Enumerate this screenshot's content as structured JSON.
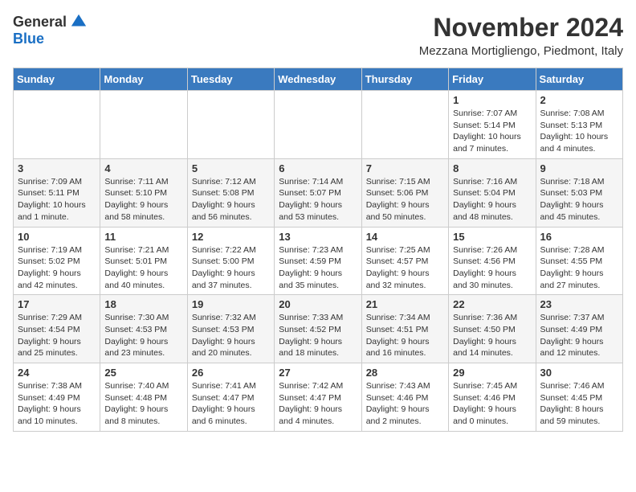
{
  "logo": {
    "general": "General",
    "blue": "Blue"
  },
  "title": "November 2024",
  "location": "Mezzana Mortigliengo, Piedmont, Italy",
  "days_of_week": [
    "Sunday",
    "Monday",
    "Tuesday",
    "Wednesday",
    "Thursday",
    "Friday",
    "Saturday"
  ],
  "weeks": [
    [
      {
        "day": "",
        "info": ""
      },
      {
        "day": "",
        "info": ""
      },
      {
        "day": "",
        "info": ""
      },
      {
        "day": "",
        "info": ""
      },
      {
        "day": "",
        "info": ""
      },
      {
        "day": "1",
        "info": "Sunrise: 7:07 AM\nSunset: 5:14 PM\nDaylight: 10 hours and 7 minutes."
      },
      {
        "day": "2",
        "info": "Sunrise: 7:08 AM\nSunset: 5:13 PM\nDaylight: 10 hours and 4 minutes."
      }
    ],
    [
      {
        "day": "3",
        "info": "Sunrise: 7:09 AM\nSunset: 5:11 PM\nDaylight: 10 hours and 1 minute."
      },
      {
        "day": "4",
        "info": "Sunrise: 7:11 AM\nSunset: 5:10 PM\nDaylight: 9 hours and 58 minutes."
      },
      {
        "day": "5",
        "info": "Sunrise: 7:12 AM\nSunset: 5:08 PM\nDaylight: 9 hours and 56 minutes."
      },
      {
        "day": "6",
        "info": "Sunrise: 7:14 AM\nSunset: 5:07 PM\nDaylight: 9 hours and 53 minutes."
      },
      {
        "day": "7",
        "info": "Sunrise: 7:15 AM\nSunset: 5:06 PM\nDaylight: 9 hours and 50 minutes."
      },
      {
        "day": "8",
        "info": "Sunrise: 7:16 AM\nSunset: 5:04 PM\nDaylight: 9 hours and 48 minutes."
      },
      {
        "day": "9",
        "info": "Sunrise: 7:18 AM\nSunset: 5:03 PM\nDaylight: 9 hours and 45 minutes."
      }
    ],
    [
      {
        "day": "10",
        "info": "Sunrise: 7:19 AM\nSunset: 5:02 PM\nDaylight: 9 hours and 42 minutes."
      },
      {
        "day": "11",
        "info": "Sunrise: 7:21 AM\nSunset: 5:01 PM\nDaylight: 9 hours and 40 minutes."
      },
      {
        "day": "12",
        "info": "Sunrise: 7:22 AM\nSunset: 5:00 PM\nDaylight: 9 hours and 37 minutes."
      },
      {
        "day": "13",
        "info": "Sunrise: 7:23 AM\nSunset: 4:59 PM\nDaylight: 9 hours and 35 minutes."
      },
      {
        "day": "14",
        "info": "Sunrise: 7:25 AM\nSunset: 4:57 PM\nDaylight: 9 hours and 32 minutes."
      },
      {
        "day": "15",
        "info": "Sunrise: 7:26 AM\nSunset: 4:56 PM\nDaylight: 9 hours and 30 minutes."
      },
      {
        "day": "16",
        "info": "Sunrise: 7:28 AM\nSunset: 4:55 PM\nDaylight: 9 hours and 27 minutes."
      }
    ],
    [
      {
        "day": "17",
        "info": "Sunrise: 7:29 AM\nSunset: 4:54 PM\nDaylight: 9 hours and 25 minutes."
      },
      {
        "day": "18",
        "info": "Sunrise: 7:30 AM\nSunset: 4:53 PM\nDaylight: 9 hours and 23 minutes."
      },
      {
        "day": "19",
        "info": "Sunrise: 7:32 AM\nSunset: 4:53 PM\nDaylight: 9 hours and 20 minutes."
      },
      {
        "day": "20",
        "info": "Sunrise: 7:33 AM\nSunset: 4:52 PM\nDaylight: 9 hours and 18 minutes."
      },
      {
        "day": "21",
        "info": "Sunrise: 7:34 AM\nSunset: 4:51 PM\nDaylight: 9 hours and 16 minutes."
      },
      {
        "day": "22",
        "info": "Sunrise: 7:36 AM\nSunset: 4:50 PM\nDaylight: 9 hours and 14 minutes."
      },
      {
        "day": "23",
        "info": "Sunrise: 7:37 AM\nSunset: 4:49 PM\nDaylight: 9 hours and 12 minutes."
      }
    ],
    [
      {
        "day": "24",
        "info": "Sunrise: 7:38 AM\nSunset: 4:49 PM\nDaylight: 9 hours and 10 minutes."
      },
      {
        "day": "25",
        "info": "Sunrise: 7:40 AM\nSunset: 4:48 PM\nDaylight: 9 hours and 8 minutes."
      },
      {
        "day": "26",
        "info": "Sunrise: 7:41 AM\nSunset: 4:47 PM\nDaylight: 9 hours and 6 minutes."
      },
      {
        "day": "27",
        "info": "Sunrise: 7:42 AM\nSunset: 4:47 PM\nDaylight: 9 hours and 4 minutes."
      },
      {
        "day": "28",
        "info": "Sunrise: 7:43 AM\nSunset: 4:46 PM\nDaylight: 9 hours and 2 minutes."
      },
      {
        "day": "29",
        "info": "Sunrise: 7:45 AM\nSunset: 4:46 PM\nDaylight: 9 hours and 0 minutes."
      },
      {
        "day": "30",
        "info": "Sunrise: 7:46 AM\nSunset: 4:45 PM\nDaylight: 8 hours and 59 minutes."
      }
    ]
  ]
}
